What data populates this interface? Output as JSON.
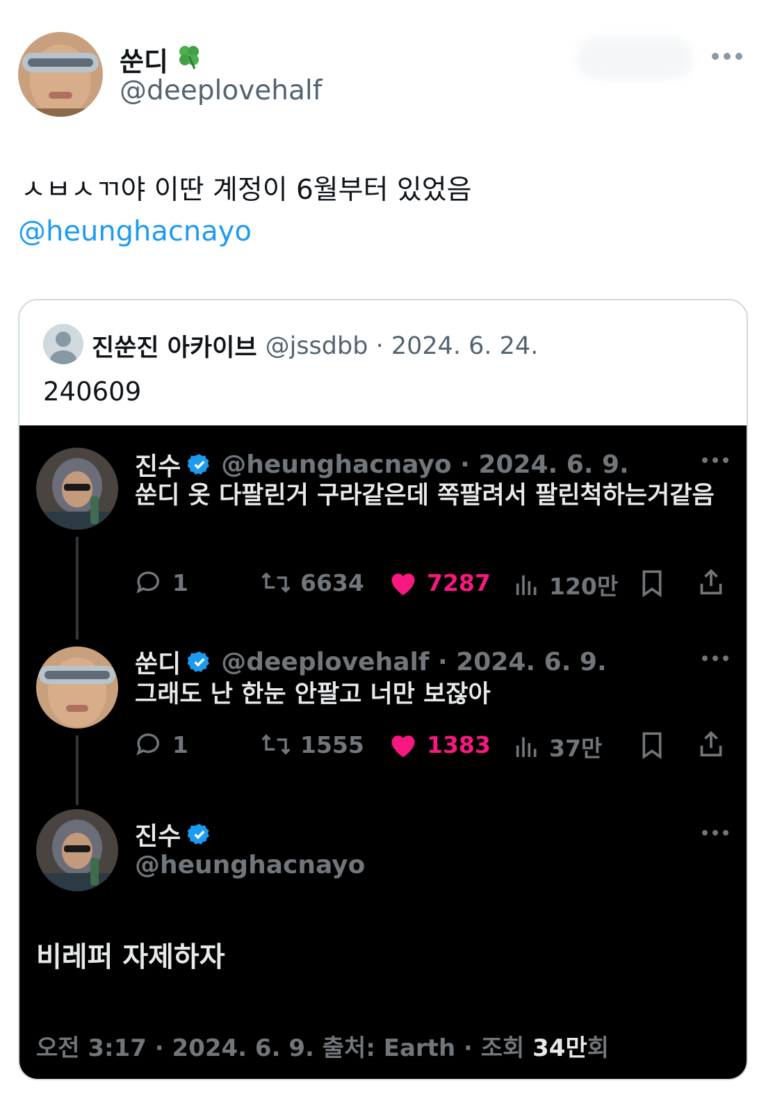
{
  "header": {
    "display_name": "쑨디",
    "name_emoji_icon": "four-leaf-clover-icon",
    "handle": "@deeplovehalf"
  },
  "tweet": {
    "text": "ㅅㅂㅅㄲ야 이딴 계정이 6월부터 있었음",
    "mention": "@heunghacnayo"
  },
  "quote": {
    "name": "진쑨진 아카이브",
    "meta": "@jssdbb · 2024. 6. 24.",
    "text": "240609",
    "embedded": {
      "post1": {
        "name": "진수",
        "meta": "@heunghacnayo · 2024. 6. 9.",
        "text": "쑨디 옷 다팔린거 구라같은데 쪽팔려서 팔린척하는거같음",
        "replies": "1",
        "reposts": "6634",
        "likes": "7287",
        "views": "120만"
      },
      "post2": {
        "name": "쑨디",
        "meta": "@deeplovehalf · 2024. 6. 9.",
        "text": "그래도 난 한눈 안팔고 너만 보잖아",
        "replies": "1",
        "reposts": "1555",
        "likes": "1383",
        "views": "37만"
      },
      "post3": {
        "name": "진수",
        "handle": "@heunghacnayo",
        "text": "비레퍼 자제하자",
        "footer_pre": "오전 3:17 · 2024. 6. 9. 출처: Earth · 조회 ",
        "footer_views": "34만",
        "footer_post": "회"
      }
    }
  },
  "colors": {
    "link_blue": "#1d9bf0",
    "like_pink": "#f91880",
    "verified_blue": "#1d9bf0",
    "dark_bg": "#000000",
    "muted": "#71767b"
  }
}
